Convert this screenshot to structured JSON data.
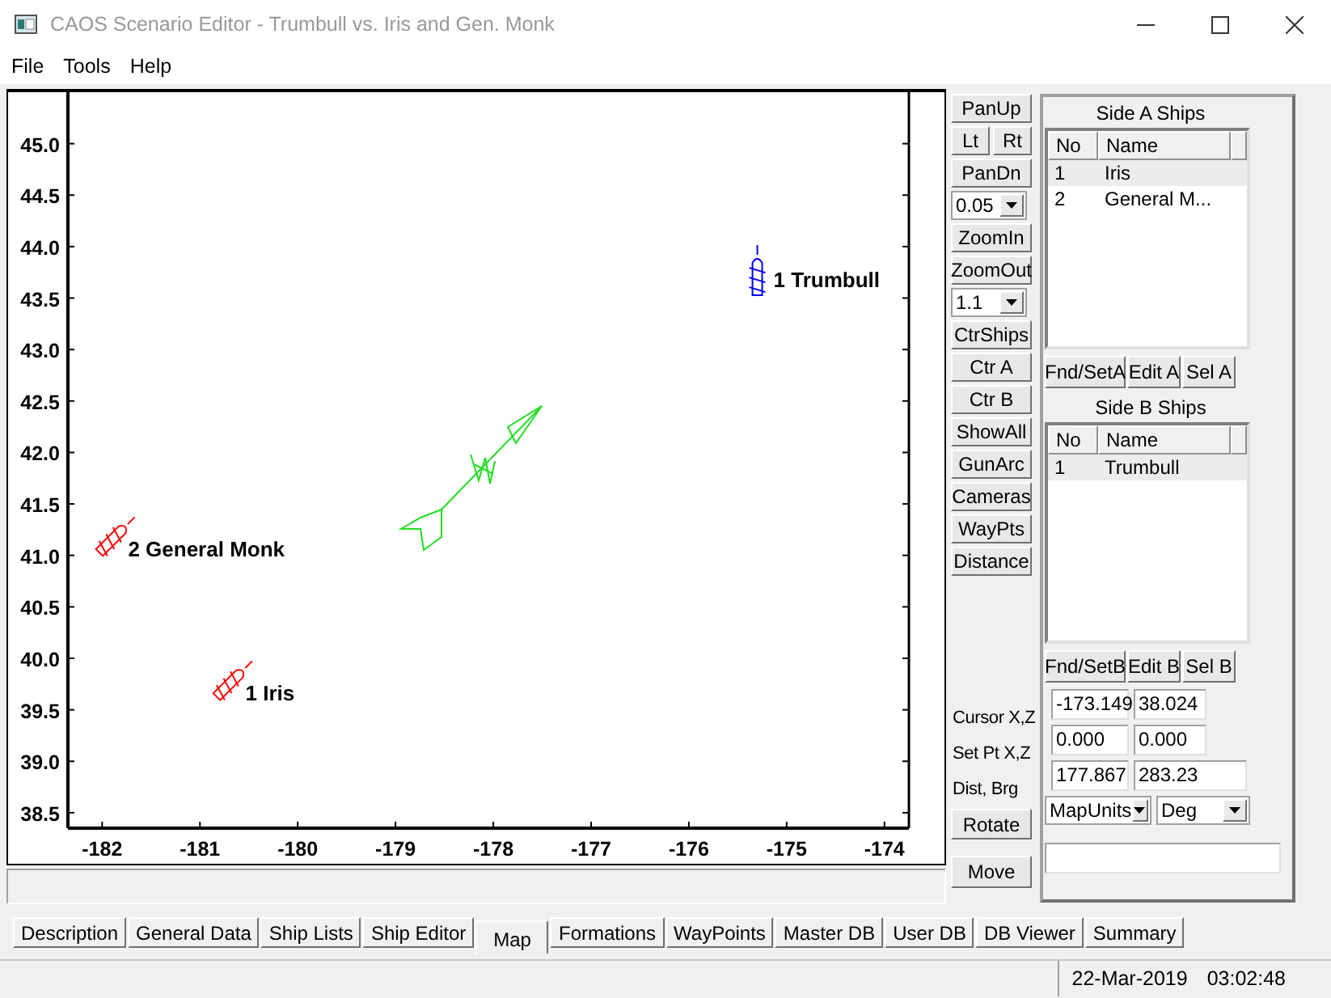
{
  "window": {
    "title": "CAOS Scenario Editor - Trumbull vs. Iris and Gen. Monk"
  },
  "menu": [
    "File",
    "Tools",
    "Help"
  ],
  "map": {
    "chart_data": {
      "type": "scatter",
      "x": [
        -181.9,
        -180.7,
        -175.3
      ],
      "series": [
        {
          "name": "2 General Monk",
          "color": "#ff0000",
          "values": [
            41.15,
            null,
            null
          ]
        },
        {
          "name": "1 Iris",
          "color": "#ff0000",
          "values": [
            null,
            39.75,
            null
          ]
        },
        {
          "name": "1 Trumbull",
          "color": "#0000ff",
          "values": [
            null,
            null,
            43.7
          ]
        }
      ],
      "legend": "center",
      "xlim": [
        -182.35,
        -173.75
      ],
      "ylim": [
        38.35,
        45.5
      ],
      "xticks": [
        -182,
        -181,
        -180,
        -179,
        -178,
        -177,
        -176,
        -175,
        -174
      ],
      "yticks": [
        {
          "value": 38.5,
          "label": "38.5"
        },
        {
          "value": 39,
          "label": "39.0"
        },
        {
          "value": 39.5,
          "label": "39.5"
        },
        {
          "value": 40,
          "label": "40.0"
        },
        {
          "value": 40.5,
          "label": "40.5"
        },
        {
          "value": 41,
          "label": "41.0"
        },
        {
          "value": 41.5,
          "label": "41.5"
        },
        {
          "value": 42,
          "label": "42.0"
        },
        {
          "value": 42.5,
          "label": "42.5"
        },
        {
          "value": 43,
          "label": "43.0"
        },
        {
          "value": 43.5,
          "label": "43.5"
        },
        {
          "value": 44,
          "label": "44.0"
        },
        {
          "value": 44.5,
          "label": "44.5"
        },
        {
          "value": 45,
          "label": "45.0"
        }
      ]
    }
  },
  "map_controls": [
    {
      "kind": "button",
      "label": "PanUp"
    },
    {
      "kind": "pair",
      "labels": [
        "Lt",
        "Rt"
      ]
    },
    {
      "kind": "button",
      "label": "PanDn"
    },
    {
      "kind": "dropdown",
      "value": "0.05"
    },
    {
      "kind": "button",
      "label": "ZoomIn"
    },
    {
      "kind": "button",
      "label": "ZoomOut"
    },
    {
      "kind": "dropdown",
      "value": "1.1"
    },
    {
      "kind": "button",
      "label": "CtrShips"
    },
    {
      "kind": "button",
      "label": "Ctr A"
    },
    {
      "kind": "button",
      "label": "Ctr B"
    },
    {
      "kind": "button",
      "label": "ShowAll"
    },
    {
      "kind": "button",
      "label": "GunArc"
    },
    {
      "kind": "button",
      "label": "Cameras"
    },
    {
      "kind": "button",
      "label": "WayPts"
    },
    {
      "kind": "button",
      "label": "Distance"
    }
  ],
  "side_lists": [
    {
      "title": "Side A Ships",
      "columns": [
        "No",
        "Name"
      ],
      "rows": [
        {
          "cells": [
            "1",
            "Iris"
          ],
          "selected": true
        },
        {
          "cells": [
            "2",
            "General M..."
          ],
          "selected": false
        }
      ],
      "buttons": [
        "Fnd/SetA",
        "Edit A",
        "Sel A"
      ]
    },
    {
      "title": "Side B Ships",
      "columns": [
        "No",
        "Name"
      ],
      "rows": [
        {
          "cells": [
            "1",
            "Trumbull"
          ],
          "selected": true
        }
      ],
      "buttons": [
        "Fnd/SetB",
        "Edit B",
        "Sel B"
      ]
    }
  ],
  "readouts": [
    {
      "label": "Cursor X,Z",
      "values": [
        "-173.149",
        "38.024"
      ]
    },
    {
      "label": "Set Pt X,Z",
      "values": [
        "0.000",
        "0.000"
      ]
    },
    {
      "label": "Dist, Brg",
      "values": [
        "177.867",
        "283.23"
      ]
    }
  ],
  "rotate_button": "Rotate",
  "unit_dropdowns": [
    "MapUnits",
    "Deg"
  ],
  "move_button": "Move",
  "tabs": [
    {
      "label": "Description",
      "selected": false
    },
    {
      "label": "General Data",
      "selected": false
    },
    {
      "label": "Ship Lists",
      "selected": false
    },
    {
      "label": "Ship Editor",
      "selected": false
    },
    {
      "label": "Map",
      "selected": true
    },
    {
      "label": "Formations",
      "selected": false
    },
    {
      "label": "WayPoints",
      "selected": false
    },
    {
      "label": "Master DB",
      "selected": false
    },
    {
      "label": "User DB",
      "selected": false
    },
    {
      "label": "DB Viewer",
      "selected": false
    },
    {
      "label": "Summary",
      "selected": false
    }
  ],
  "status_bar": {
    "date": "22-Mar-2019",
    "time": "03:02:48"
  }
}
